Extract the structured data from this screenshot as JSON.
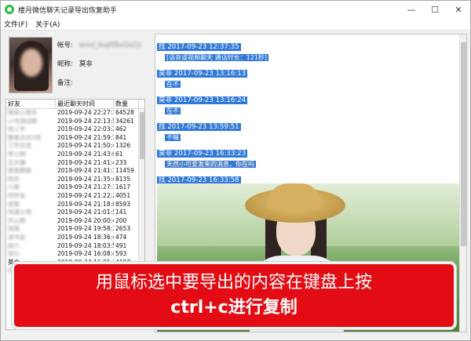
{
  "window": {
    "title": "楼月微信聊天记录导出恢复助手",
    "controls": [
      "—",
      "☐",
      "✕"
    ]
  },
  "menu": [
    "文件(F)",
    "关于(A)"
  ],
  "profile": {
    "account_label": "帐号:",
    "account_value": "wxid_lkq0f8vl2e22",
    "nick_label": "昵称:",
    "nick_value": "莫非",
    "note_label": "备注:",
    "note_value": ""
  },
  "contact_list": {
    "headers": [
      "好友",
      "最近聊天时间",
      "数量"
    ],
    "rows": [
      [
        "佛系小青年",
        "2019-09-24 22:27:39",
        "64528"
      ],
      [
        "小号测试群",
        "2019-09-24 22:13:51",
        "34261"
      ],
      [
        "张三丰",
        "2019-09-24 22:03:20",
        "462"
      ],
      [
        "繁星点点2班",
        "2019-09-24 21:59:16",
        "841"
      ],
      [
        "工作交流",
        "2019-09-24 21:50:41",
        "1326"
      ],
      [
        "李小明",
        "2019-09-24 21:43:01",
        "61"
      ],
      [
        "王大锤",
        "2019-09-24 21:41:40",
        "233"
      ],
      [
        "家族群聊",
        "2019-09-24 21:41:33",
        "11459"
      ],
      [
        "阿杰",
        "2019-09-24 21:35:41",
        "8135"
      ],
      [
        "小美",
        "2019-09-24 21:27:18",
        "1617"
      ],
      [
        "同学会",
        "2019-09-24 21:22:22",
        "4051"
      ],
      [
        "老陈",
        "2019-09-24 21:18:06",
        "8593"
      ],
      [
        "快递小哥",
        "2019-09-24 21:01:59",
        "141"
      ],
      [
        "开心群",
        "2019-09-24 20:00:44",
        "200"
      ],
      [
        "周周",
        "2019-09-24 19:58:38",
        "2653"
      ],
      [
        "读书会",
        "2019-09-24 18:36:41",
        "474"
      ],
      [
        "赵六",
        "2019-09-24 18:03:55",
        "491"
      ],
      [
        "钱七",
        "2019-09-24 16:08:42",
        "593"
      ],
      [
        "莫非",
        "2019-09-24 16:05:26",
        "4187"
      ],
      [
        "孙八",
        "2019-09-24 15:55:12",
        "82"
      ]
    ]
  },
  "chat": {
    "messages": [
      {
        "header": "找 2017-09-23 12:37:35",
        "body": "[语音或视频聊天 通话时长：121秒]"
      },
      {
        "header": "莫非 2017-09-23 13:16:13",
        "body": "在不"
      },
      {
        "header": "莫非 2017-09-23 13:16:24",
        "body": "在不"
      },
      {
        "header": "找 2017-09-23 13:59:51",
        "body": "干嘛"
      },
      {
        "header": "莫非 2017-09-23 16:33:23",
        "body": "天然小可爱发来的消息，你在吗"
      },
      {
        "header": "找 2017-09-23 16:33:58",
        "body": ""
      }
    ]
  },
  "banner": {
    "line1": "用鼠标选中要导出的内容在键盘上按",
    "line2": "ctrl+c进行复制"
  },
  "colors": {
    "selection": "#3079d8",
    "banner": "#e30c14",
    "app_icon": "#2dbd3e"
  }
}
